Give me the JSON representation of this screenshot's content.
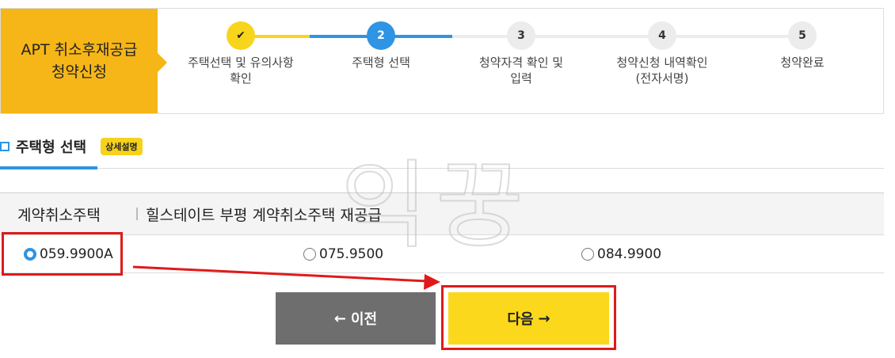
{
  "header": {
    "title_line1": "APT 취소후재공급",
    "title_line2": "청약신청"
  },
  "stepper": {
    "steps": [
      {
        "number": "✔",
        "label_line1": "주택선택 및 유의사항",
        "label_line2": "확인",
        "state": "done"
      },
      {
        "number": "2",
        "label_line1": "주택형 선택",
        "label_line2": "",
        "state": "current"
      },
      {
        "number": "3",
        "label_line1": "청약자격 확인 및",
        "label_line2": "입력",
        "state": "todo"
      },
      {
        "number": "4",
        "label_line1": "청약신청 내역확인",
        "label_line2": "(전자서명)",
        "state": "todo"
      },
      {
        "number": "5",
        "label_line1": "청약완료",
        "label_line2": "",
        "state": "todo"
      }
    ],
    "colors": {
      "done": "#f8d51d",
      "current": "#2e94e3",
      "todo": "#ececec",
      "todo_text": "#333333"
    }
  },
  "section": {
    "title": "주택형 선택",
    "badge": "상세설명"
  },
  "table": {
    "type_label": "계약취소주택",
    "complex_name": "힐스테이트 부평 계약취소주택 재공급",
    "options": [
      {
        "label": "059.9900A",
        "checked": true
      },
      {
        "label": "075.9500",
        "checked": false
      },
      {
        "label": "084.9900",
        "checked": false
      }
    ]
  },
  "buttons": {
    "prev_arrow": "←",
    "prev_label": "이전",
    "next_label": "다음",
    "next_arrow": "→"
  },
  "watermark": "익꿍"
}
